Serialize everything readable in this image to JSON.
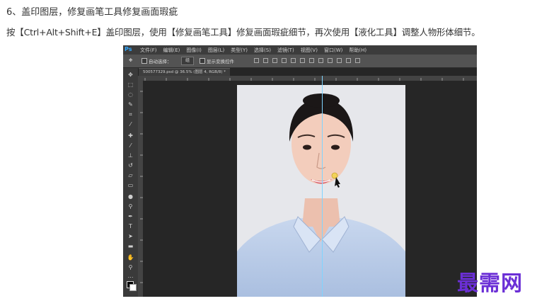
{
  "article": {
    "step_title": "6、盖印图层，修复画笔工具修复画面瑕疵",
    "step_desc": "按【Ctrl+Alt+Shift+E】盖印图层，使用【修复画笔工具】修复画面瑕疵细节，再次使用【液化工具】调整人物形体细节。"
  },
  "app": {
    "logo": "Ps",
    "menu": [
      "文件(F)",
      "编辑(E)",
      "图像(I)",
      "图层(L)",
      "类型(Y)",
      "选择(S)",
      "滤镜(T)",
      "视图(V)",
      "窗口(W)",
      "帮助(H)"
    ],
    "options": {
      "auto_select_label": "自动选择：",
      "auto_select_value": "组",
      "show_transform_label": "显示变换控件"
    },
    "document_tab": "500577329.psd @ 36.5% (图层 4, RGB/8) *"
  },
  "watermark": "最需网"
}
